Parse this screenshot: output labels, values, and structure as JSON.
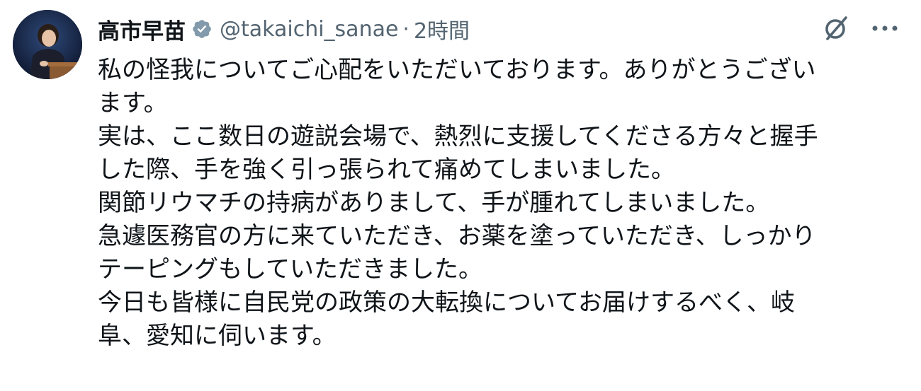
{
  "author": {
    "name": "高市早苗",
    "handle": "@takaichi_sanae",
    "separator": "·",
    "time": "2時間",
    "verified": true
  },
  "icons": {
    "avatar": "profile-photo",
    "verified": "verified-badge-icon",
    "grok": "grok-icon",
    "more": "more-options-icon"
  },
  "colors": {
    "text": "#0f1419",
    "secondary": "#536471",
    "verified_badge": "#829aab"
  },
  "tweet": {
    "lines": [
      "私の怪我についてご心配をいただいております。ありがとうござい",
      "ます。",
      "実は、ここ数日の遊説会場で、熱烈に支援してくださる方々と握手",
      "した際、手を強く引っ張られて痛めてしまいました。",
      "関節リウマチの持病がありまして、手が腫れてしまいました。",
      "急遽医務官の方に来ていただき、お薬を塗っていただき、しっかり",
      "テーピングもしていただきました。",
      "今日も皆様に自民党の政策の大転換についてお届けするべく、岐",
      "阜、愛知に伺います。"
    ]
  }
}
